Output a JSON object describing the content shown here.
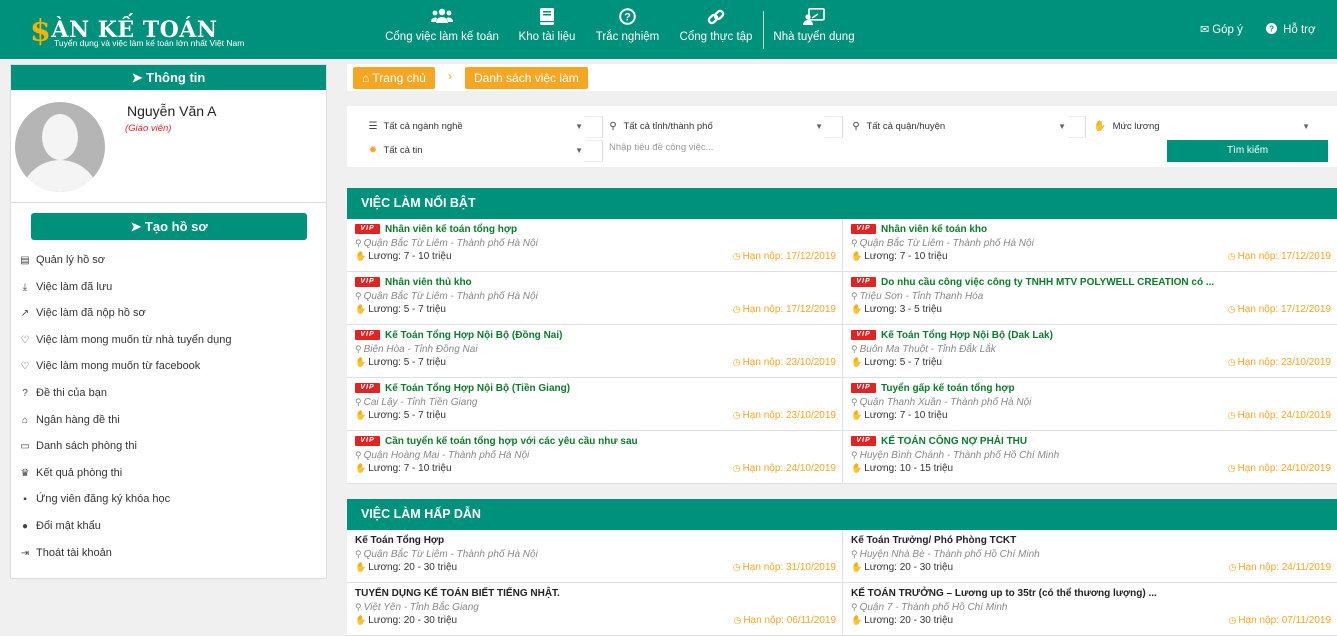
{
  "header": {
    "logo_title": "ÀN KẾ TOÁN",
    "logo_dollar": "$",
    "logo_sub": "Tuyển dụng và việc làm kế toán lớn nhất Việt Nam",
    "nav": [
      {
        "label": "Cổng việc làm kế toán",
        "icon": "people-icon"
      },
      {
        "label": "Kho tài liệu",
        "icon": "book-icon"
      },
      {
        "label": "Trắc nghiệm",
        "icon": "question-circle-icon"
      },
      {
        "label": "Cổng thực tập",
        "icon": "link-icon"
      },
      {
        "label": "Nhà tuyển dụng",
        "icon": "employer-icon"
      }
    ],
    "feedback": "Góp ý",
    "support": "Hỗ trợ"
  },
  "sidebar": {
    "title": "Thông tin",
    "user_name": "Nguyễn Văn A",
    "user_role": "(Giáo viên)",
    "create_button": "Tạo hồ sơ",
    "menu": [
      {
        "label": "Quản lý hồ sơ",
        "icon": "id-card-icon"
      },
      {
        "label": "Việc làm đã lưu",
        "icon": "download-icon"
      },
      {
        "label": "Việc làm đã nộp hồ sơ",
        "icon": "share-icon"
      },
      {
        "label": "Việc làm mong muốn từ nhà tuyển dụng",
        "icon": "heart-icon"
      },
      {
        "label": "Việc làm mong muốn từ facebook",
        "icon": "heart-icon"
      },
      {
        "label": "Đề thi của bạn",
        "icon": "question-circle-icon"
      },
      {
        "label": "Ngân hàng đề thi",
        "icon": "bank-icon"
      },
      {
        "label": "Danh sách phòng thi",
        "icon": "cast-icon"
      },
      {
        "label": "Kết quả phòng thi",
        "icon": "crown-icon"
      },
      {
        "label": "Ứng viên đăng ký khóa học",
        "icon": "user-board-icon"
      },
      {
        "label": "Đổi mật khẩu",
        "icon": "user-circle-icon"
      },
      {
        "label": "Thoát tài khoản",
        "icon": "sign-out-icon"
      }
    ]
  },
  "breadcrumb": {
    "home": "Trang chủ",
    "current": "Danh sách việc làm"
  },
  "search": {
    "industry": "Tất cả ngành nghề",
    "city": "Tất cả tỉnh/thành phố",
    "district": "Tất cả quận/huyện",
    "salary": "Mức lương",
    "news": "Tất cả tin",
    "keyword_placeholder": "Nhập tiêu đề công việc...",
    "button": "Tìm kiếm"
  },
  "featured": {
    "title": "VIỆC LÀM NỔI BẬT",
    "vip_label": "VIP",
    "jobs": [
      {
        "title": "Nhân viên kế toán tổng hợp",
        "location": "Quận Bắc Từ Liêm - Thành phố Hà Nội",
        "salary": "Lương: 7 - 10 triệu",
        "deadline": "Hạn nộp: 17/12/2019"
      },
      {
        "title": "Nhân viên kế toán kho",
        "location": "Quận Bắc Từ Liêm - Thành phố Hà Nội",
        "salary": "Lương: 7 - 10 triệu",
        "deadline": "Hạn nộp: 17/12/2019"
      },
      {
        "title": "Nhân viên thủ kho",
        "location": "Quận Bắc Từ Liêm - Thành phố Hà Nội",
        "salary": "Lương: 5 - 7 triệu",
        "deadline": "Hạn nộp: 17/12/2019"
      },
      {
        "title": "Do nhu cầu công việc công ty TNHH MTV POLYWELL CREATION có ...",
        "location": "Triệu Sơn - Tỉnh Thanh Hóa",
        "salary": "Lương: 3 - 5 triệu",
        "deadline": "Hạn nộp: 17/12/2019"
      },
      {
        "title": "Kế Toán Tổng Hợp Nội Bộ (Đồng Nai)",
        "location": "Biên Hòa - Tỉnh Đồng Nai",
        "salary": "Lương: 5 - 7 triệu",
        "deadline": "Hạn nộp: 23/10/2019"
      },
      {
        "title": "Kế Toán Tổng Hợp Nội Bộ (Dak Lak)",
        "location": "Buôn Ma Thuột - Tỉnh Đắk Lắk",
        "salary": "Lương: 5 - 7 triệu",
        "deadline": "Hạn nộp: 23/10/2019"
      },
      {
        "title": "Kế Toán Tổng Hợp Nội Bộ (Tiền Giang)",
        "location": "Cai Lậy - Tỉnh Tiền Giang",
        "salary": "Lương: 5 - 7 triệu",
        "deadline": "Hạn nộp: 23/10/2019"
      },
      {
        "title": "Tuyển gấp kế toán tổng hợp",
        "location": "Quận Thanh Xuân - Thành phố Hà Nội",
        "salary": "Lương: 7 - 10 triệu",
        "deadline": "Hạn nộp: 24/10/2019"
      },
      {
        "title": "Cần tuyển kế toán tổng hợp với các yêu cầu như sau",
        "location": "Quận Hoàng Mai - Thành phố Hà Nội",
        "salary": "Lương: 7 - 10 triệu",
        "deadline": "Hạn nộp: 24/10/2019"
      },
      {
        "title": "KẾ TOÁN CÔNG NỢ PHẢI THU",
        "location": "Huyện Bình Chánh - Thành phố Hồ Chí Minh",
        "salary": "Lương: 10 - 15 triệu",
        "deadline": "Hạn nộp: 24/10/2019"
      }
    ]
  },
  "attractive": {
    "title": "VIỆC LÀM HẤP DẪN",
    "jobs": [
      {
        "title": "Kế Toán Tổng Hợp",
        "location": "Quận Bắc Từ Liêm - Thành phố Hà Nội",
        "salary": "Lương: 20 - 30 triệu",
        "deadline": "Hạn nộp: 31/10/2019"
      },
      {
        "title": "Kế Toán Trưởng/ Phó Phòng TCKT",
        "location": "Huyện Nhà Bè - Thành phố Hồ Chí Minh",
        "salary": "Lương: 20 - 30 triệu",
        "deadline": "Hạn nộp: 24/11/2019"
      },
      {
        "title": "TUYỂN DỤNG KẾ TOÁN BIẾT TIẾNG NHẬT.",
        "location": "Việt Yên - Tỉnh Bắc Giang",
        "salary": "Lương: 20 - 30 triệu",
        "deadline": "Hạn nộp: 06/11/2019"
      },
      {
        "title": "KẾ TOÁN TRƯỞNG – Lương up to 35tr (có thể thương lượng) ...",
        "location": "Quận 7 - Thành phố Hồ Chí Minh",
        "salary": "Lương: 20 - 30 triệu",
        "deadline": "Hạn nộp: 07/11/2019"
      }
    ]
  }
}
